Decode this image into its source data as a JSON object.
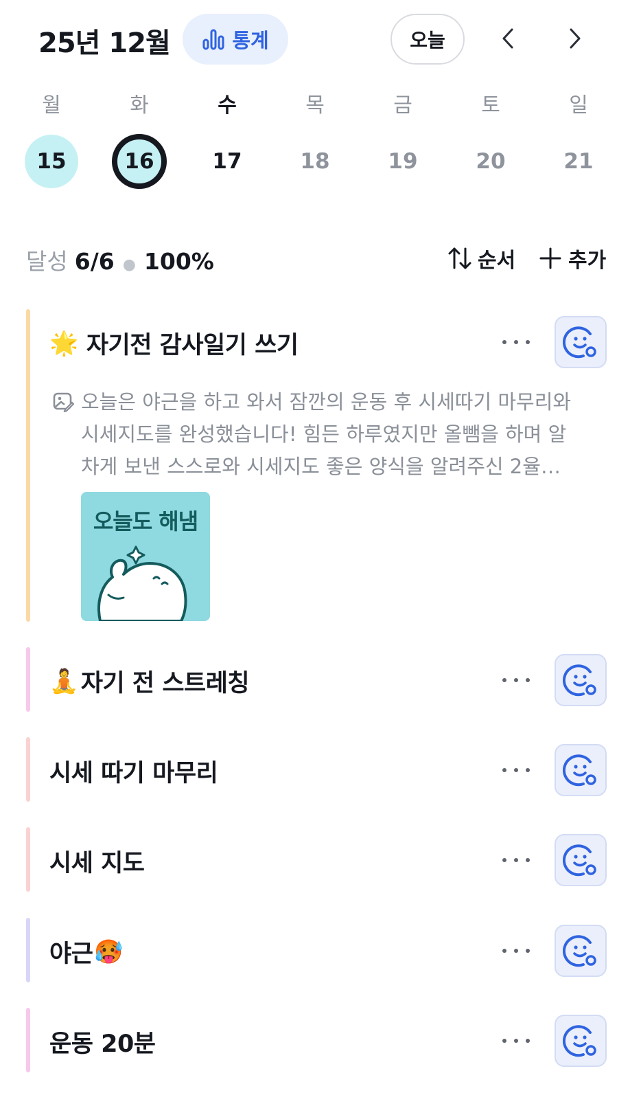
{
  "header": {
    "month_title": "25년 12월",
    "stats_label": "통계",
    "today_label": "오늘",
    "accent_color": "#2f63e0"
  },
  "week": {
    "days": [
      {
        "weekday": "월",
        "date": "15"
      },
      {
        "weekday": "화",
        "date": "16"
      },
      {
        "weekday": "수",
        "date": "17"
      },
      {
        "weekday": "목",
        "date": "18"
      },
      {
        "weekday": "금",
        "date": "19"
      },
      {
        "weekday": "토",
        "date": "20"
      },
      {
        "weekday": "일",
        "date": "21"
      }
    ]
  },
  "summary": {
    "label": "달성",
    "count": "6/6",
    "percent": "100%",
    "sort_label": "순서",
    "add_label": "추가"
  },
  "tasks": [
    {
      "emoji": "🌟",
      "title": "자기전 감사일기 쓰기",
      "color": "#fbd9a6",
      "memo": [
        "오늘은 야근을 하고 와서 잠깐의 운동 후 시세따기 마무리와",
        "시세지도를 완성했습니다! 힘든 하루였지만 올뺌을 하며 알",
        "차게 보낸 스스로와 시세지도 좋은 양식을 알려주신 2율…"
      ],
      "sticker_text": "오늘도 해냄"
    },
    {
      "emoji": "🧘",
      "title": "자기 전 스트레칭",
      "color": "#f8c8ea"
    },
    {
      "emoji": "",
      "title": "시세 따기 마무리",
      "color": "#fbd2d2"
    },
    {
      "emoji": "",
      "title": "시세 지도",
      "color": "#fbd2d2"
    },
    {
      "emoji": "🥵",
      "title": "야근",
      "color": "#d7d6f8"
    },
    {
      "emoji": "",
      "title": "운동 20분",
      "color": "#f8c8ea"
    }
  ]
}
